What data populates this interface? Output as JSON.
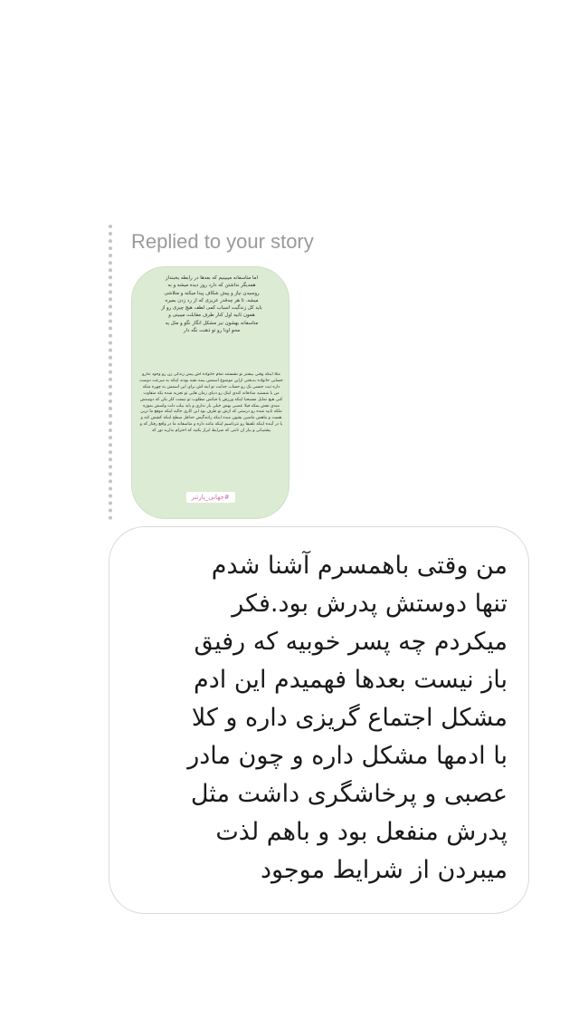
{
  "reply": {
    "header": "Replied to your story"
  },
  "story": {
    "paragraph1": "اما متاسفانه میبینیم که بعدها در رابطه یخبنداز همدیگر نداشتن که دارد روز دیده میشه و به روسیدن نیاز و پیش شکاف پیدا میکنه و متلاشی میشه. تا هر چه‌قدر عزیزی که از رد زدن بمیره باید کل زندگیت اسباب کمی لطف هیچ چیزی رو از همون ثانیه اول کنار طرف مقابلت میبینی و متاسفانه بهشون نیز مشکل انگار نگو و مثل یه محو اونا رو تو ذهنت نگه دار",
    "paragraph2": "مثلا اینکه وقتی بیشتر تو نشستند تمام خانواده اش پیش زندگی زن رو وجود ندارو جسایی خانواده بدبختی ازاین موضوع اسمش بیمه نشه بودند اینکه به سرعت دوست داره ثبت جنسی یک رو حساب جدایت تو اینه اش برای این اسمش به چهره منکه من با شستید صادقانه کندی اینک رو دنیای زمان هایی تو تجربه شده یکه متفاوت کنی هیچ تمایل مسیحیا اینکه ورزش یا فیاتش مطلوب تو تیست کلر بکن که دوستش میدی نفش یمکه فیلا عصبی بهش خیلی بار نداری و باید بیلب دلت واسش بموزه ملکه تایید شده رو درستی که ازش تو طرف بود این کاری جالبه اینکه موقع ما ترین هست و ماهش ماشین بشون میده اینکه رانندگیش حداقل سطح اینکه کشش کنه و یا در آینده اینکه تلفیقا رو نترناسیم اینکه مانند داره و متاسفانه ما در واقع رفتار که و پشتیبانی و بیار ان ثابتی که شرایط ابراز بکنید که احترام بذارید تور که",
    "tag": "#جهانی_پارتنر"
  },
  "message": {
    "lines": [
      "من وقتی باهمسرم آشنا شدم",
      "تنها دوستش پدرش بود.فکر",
      "میکردم چه پسر خوبیه که رفیق",
      "باز نیست بعدها فهمیدم این ادم",
      "مشکل اجتماع گریزی داره و کلا",
      "با ادمها مشکل داره و چون مادر",
      "عصبی و پرخاشگری داشت مثل",
      "پدرش منفعل بود و باهم لذت",
      "میبردن از شرایط موجود"
    ]
  }
}
